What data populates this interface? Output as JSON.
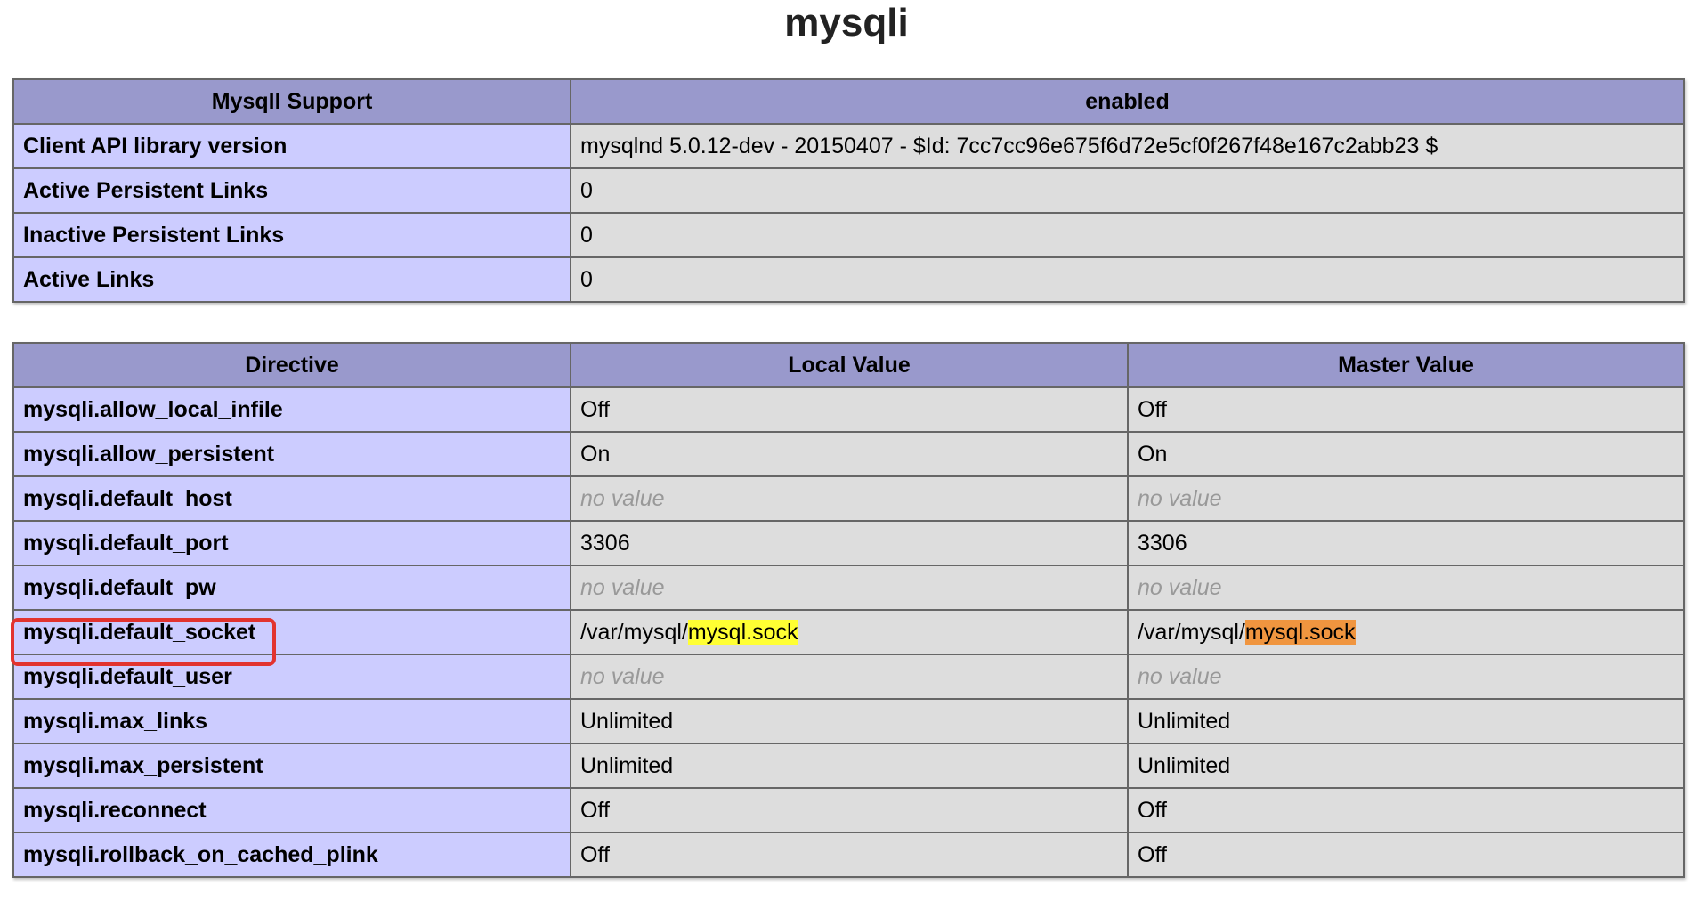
{
  "title": "mysqli",
  "support_table": {
    "header": [
      "MysqlI Support",
      "enabled"
    ],
    "rows": [
      {
        "name": "Client API library version",
        "value": "mysqlnd 5.0.12-dev - 20150407 - $Id: 7cc7cc96e675f6d72e5cf0f267f48e167c2abb23 $"
      },
      {
        "name": "Active Persistent Links",
        "value": "0"
      },
      {
        "name": "Inactive Persistent Links",
        "value": "0"
      },
      {
        "name": "Active Links",
        "value": "0"
      }
    ]
  },
  "directive_table": {
    "header": [
      "Directive",
      "Local Value",
      "Master Value"
    ],
    "rows": [
      {
        "name": "mysqli.allow_local_infile",
        "local": "Off",
        "master": "Off"
      },
      {
        "name": "mysqli.allow_persistent",
        "local": "On",
        "master": "On"
      },
      {
        "name": "mysqli.default_host",
        "local": "no value",
        "master": "no value"
      },
      {
        "name": "mysqli.default_port",
        "local": "3306",
        "master": "3306"
      },
      {
        "name": "mysqli.default_pw",
        "local": "no value",
        "master": "no value"
      },
      {
        "name": "mysqli.default_socket",
        "local_prefix": "/var/mysql/",
        "local_highlight": "mysql.sock",
        "master_prefix": "/var/mysql/",
        "master_highlight": "mysql.sock"
      },
      {
        "name": "mysqli.default_user",
        "local": "no value",
        "master": "no value"
      },
      {
        "name": "mysqli.max_links",
        "local": "Unlimited",
        "master": "Unlimited"
      },
      {
        "name": "mysqli.max_persistent",
        "local": "Unlimited",
        "master": "Unlimited"
      },
      {
        "name": "mysqli.reconnect",
        "local": "Off",
        "master": "Off"
      },
      {
        "name": "mysqli.rollback_on_cached_plink",
        "local": "Off",
        "master": "Off"
      }
    ]
  },
  "colors": {
    "header_bg": "#9999cc",
    "name_cell_bg": "#ccccff",
    "value_cell_bg": "#dddddd",
    "no_value_text": "#999999",
    "local_highlight": "#ffff33",
    "master_highlight": "#f0953f",
    "annotation_box": "#e2332f"
  }
}
